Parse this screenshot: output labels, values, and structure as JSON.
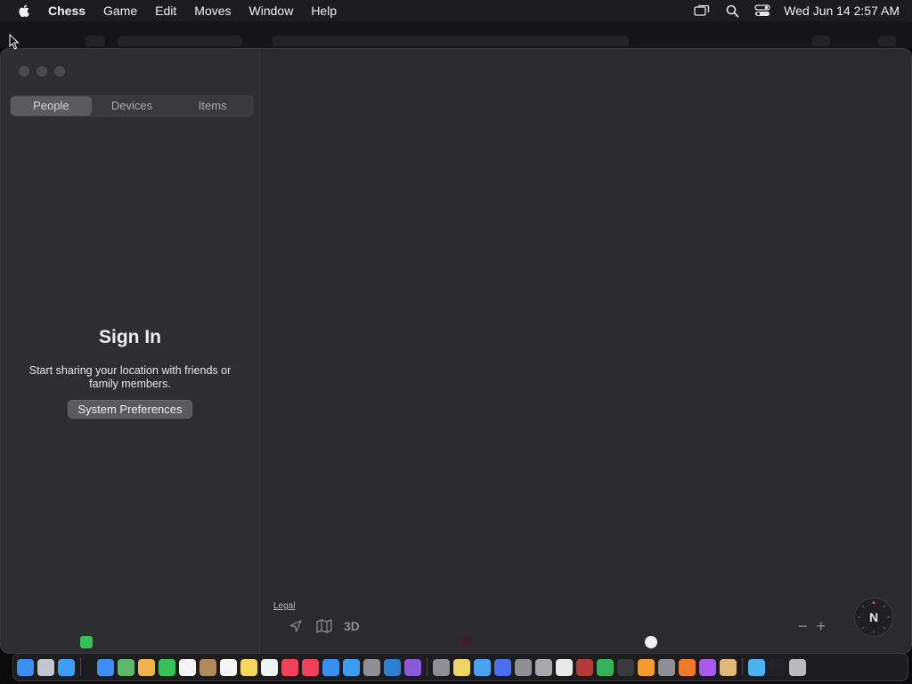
{
  "menubar": {
    "app_name": "Chess",
    "items": [
      "Game",
      "Edit",
      "Moves",
      "Window",
      "Help"
    ],
    "clock": "Wed Jun 14  2:57 AM",
    "status_icons": [
      "display-icon",
      "search-icon",
      "control-center-icon"
    ]
  },
  "window": {
    "tabs": [
      {
        "label": "People",
        "active": true
      },
      {
        "label": "Devices",
        "active": false
      },
      {
        "label": "Items",
        "active": false
      }
    ],
    "signin": {
      "title": "Sign In",
      "description": "Start sharing your location with friends or family members.",
      "button_label": "System Preferences"
    },
    "map": {
      "legal_label": "Legal",
      "mode_3d_label": "3D",
      "compass_label": "N",
      "zoom_out": "−",
      "zoom_in": "+"
    }
  },
  "dock": {
    "apps": [
      {
        "name": "finder",
        "color": "#3b8ff0"
      },
      {
        "name": "launchpad",
        "color": "#c2c6cf"
      },
      {
        "name": "safari",
        "color": "#3d9ef5"
      },
      {
        "sep": false,
        "name": "spacer",
        "color": "transparent"
      },
      {
        "name": "mail",
        "color": "#3e8ef7"
      },
      {
        "name": "maps",
        "color": "#5fb86a"
      },
      {
        "name": "photos",
        "color": "#f0b44a"
      },
      {
        "name": "facetime",
        "color": "#36c15a"
      },
      {
        "name": "calendar",
        "color": "#f4f4f4"
      },
      {
        "name": "contacts",
        "color": "#b08a5a"
      },
      {
        "name": "reminders",
        "color": "#f6f6f6"
      },
      {
        "name": "notes",
        "color": "#f7d65a"
      },
      {
        "name": "freeform",
        "color": "#eef3f8"
      },
      {
        "name": "music",
        "color": "#f2405a"
      },
      {
        "name": "news",
        "color": "#f2405a"
      },
      {
        "name": "keynote",
        "color": "#3a8ef0"
      },
      {
        "name": "app-store",
        "color": "#3a9ef5"
      },
      {
        "name": "system-settings",
        "color": "#8e8e93"
      },
      {
        "name": "vscode",
        "color": "#2f7fd0"
      },
      {
        "name": "visual-studio",
        "color": "#8a5ad8"
      },
      {
        "name": "screenshot",
        "color": "#8e8e93"
      },
      {
        "name": "stickies",
        "color": "#f1d565"
      },
      {
        "name": "cloud",
        "color": "#4aa0f2"
      },
      {
        "name": "affinity",
        "color": "#4b6ef0"
      },
      {
        "name": "font-book",
        "color": "#8e8e93"
      },
      {
        "name": "chess",
        "color": "#a9a9ad"
      },
      {
        "name": "script-editor",
        "color": "#e9e9ea"
      },
      {
        "name": "dictionary",
        "color": "#b23a3a"
      },
      {
        "name": "find-my",
        "color": "#36b35a"
      },
      {
        "name": "activity-monitor",
        "color": "#3a3a3c"
      },
      {
        "name": "books",
        "color": "#f59a2e"
      },
      {
        "name": "calculator",
        "color": "#8e8e93"
      },
      {
        "name": "firefox",
        "color": "#f07a2a"
      },
      {
        "name": "podcasts",
        "color": "#a85af0"
      },
      {
        "name": "paintbrush",
        "color": "#e0b87a"
      },
      {
        "name": "downloads-folder",
        "color": "#4ab2ee"
      },
      {
        "name": "terminal",
        "color": "#222226"
      },
      {
        "name": "trash",
        "color": "#b9b9be"
      }
    ]
  }
}
